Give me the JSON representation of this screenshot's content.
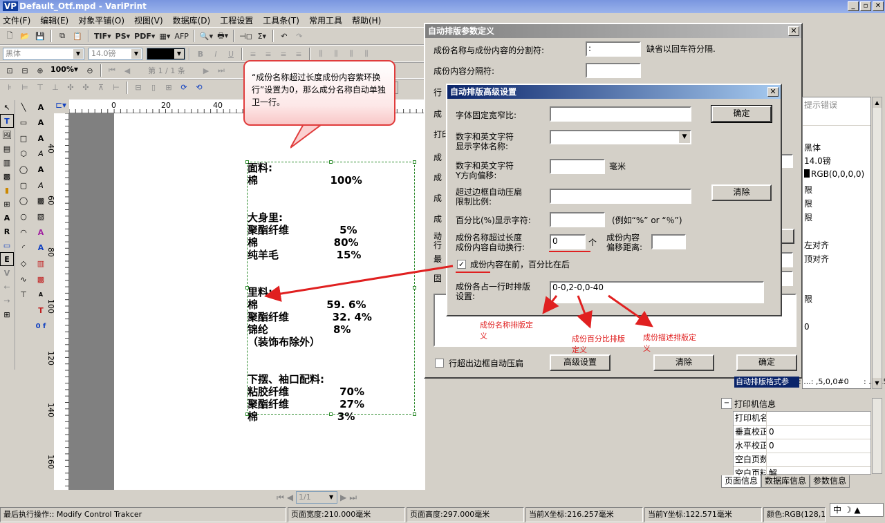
{
  "window": {
    "logo": "VP",
    "title": "Default_Otf.mpd - VariPrint"
  },
  "menu": [
    "文件(F)",
    "编辑(E)",
    "对象平铺(O)",
    "视图(V)",
    "数据库(D)",
    "工程设置",
    "工具条(T)",
    "常用工具",
    "帮助(H)"
  ],
  "toolbar1": {
    "tif": "TIF",
    "ps": "PS",
    "pdf": "PDF",
    "afp": "AFP"
  },
  "toolbar2": {
    "font": "黑体",
    "size": "14.0镑"
  },
  "toolbar3": {
    "zoom": "100%",
    "page": "第 1 / 1 条"
  },
  "rulers": {
    "top": [
      "0",
      "20",
      "40"
    ],
    "left": [
      "40",
      "60",
      "80",
      "100",
      "120",
      "140",
      "160"
    ]
  },
  "callout": "“成份名称超过长度成份内容紫环换行”设置为0，那么成分名称自动单独卫一行。",
  "doc": {
    "lines": [
      "面料:",
      "棉                    100%",
      "",
      "",
      "大身里:",
      "聚酯纤维              5%",
      "棉                     80%",
      "纯羊毛                15%",
      "",
      "",
      "里料:",
      "棉                   59. 6%",
      "聚酯纤维            32. 4%",
      "锦纶                  8%",
      "（装饰布除外）",
      "",
      "",
      "下摆、袖口配料:",
      "粘胶纤维              70%",
      "聚酯纤维              27%",
      "棉                      3%"
    ]
  },
  "dlg1": {
    "title": "自动排版参数定义",
    "sep_label": "成份名称与成份内容的分割符:",
    "sep_value": ":",
    "sep_note": "缺省以回车符分隔.",
    "content_sep_label": "成份内容分隔符:",
    "content_sep_value": "",
    "row_partial": [
      "行",
      "成",
      "打印",
      "成",
      "成",
      "成",
      "成",
      "动",
      "行",
      "最",
      "固"
    ],
    "checkbox_label": "行超出边框自动压扁",
    "adv_button": "高级设置",
    "clear_button": "清除",
    "ok_button": "确定"
  },
  "dlg2": {
    "title": "自动排版高级设置",
    "font_width_label": "字体固定宽窄比:",
    "font_width_value": "",
    "ok_button": "确定",
    "num_font_label": "数字和英文字符\n显示字体名称:",
    "num_font_value": "",
    "num_y_label": "数字和英文字符\nY方向偏移:",
    "num_y_value": "",
    "num_y_unit": "毫米",
    "compress_label": "超过边框自动压扁\n限制比例:",
    "compress_value": "",
    "clear_button": "清除",
    "percent_label": "百分比(%)显示字符:",
    "percent_value": "",
    "percent_hint": "(例如“%” or “％”)",
    "wrap_label": "成份名称超过长度\n成份内容自动换行:",
    "wrap_value": "0",
    "wrap_unit": "个",
    "offset_label": "成份内容\n偏移距离:",
    "offset_value": "",
    "content_first_label": "成份内容在前，百分比在后",
    "content_first_checked": true,
    "layout_label": "成份各占一行时排版\n设置:",
    "layout_value": "0-0,2-0,0-40"
  },
  "annotations": {
    "a1": "成份名称排版定\n义",
    "a2": "成份百分比排版\n定义",
    "a3": "成份描述排版定\n义"
  },
  "right_panel": {
    "error_hint": "提示错误",
    "font": "黑体",
    "size": "14.0镑",
    "color": "RGB(0,0,0,0)",
    "align1": "左对齐",
    "align2": "顶对齐",
    "value": "0",
    "param": "自动排版格式参",
    "param_value": ": ...: ,5,0,0#0",
    "items": [
      "限",
      "限",
      "限",
      "限"
    ]
  },
  "printer": {
    "header": "打印机信息",
    "rows": [
      {
        "k": "打印机名",
        "v": ""
      },
      {
        "k": "垂直校正",
        "v": "0"
      },
      {
        "k": "水平校正",
        "v": "0"
      },
      {
        "k": "空白页数",
        "v": ""
      },
      {
        "k": "空白页料",
        "v": "解"
      }
    ]
  },
  "tabs": [
    "页面信息",
    "数据库信息",
    "参数信息"
  ],
  "bottom_nav": {
    "page": "1/1"
  },
  "status": {
    "last_op": "最后执行操作:: Modify Control Trakcer",
    "width": "页面宽度:210.000毫米",
    "height": "页面高度:297.000毫米",
    "x": "当前X坐标:216.257毫米",
    "y": "当前Y坐标:122.571毫米",
    "color": "颜色:RGB(128,128"
  },
  "ime": "中"
}
